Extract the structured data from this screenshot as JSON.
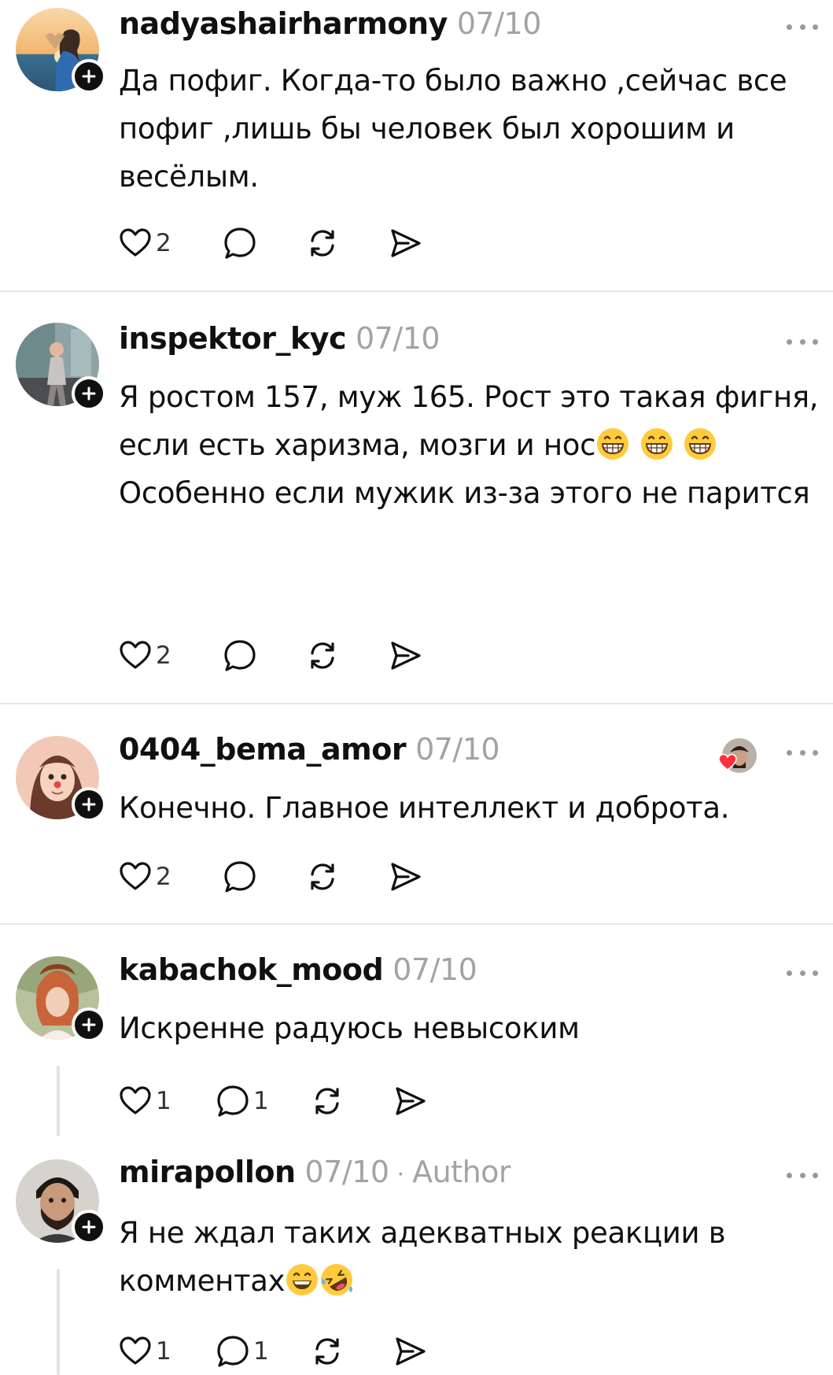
{
  "colors": {
    "text": "#101010",
    "muted": "#a3a3a3",
    "divider": "#e6e6e6",
    "heart_red": "#ff2d3f",
    "emoji_yellow": "#ffcb3d"
  },
  "posts": [
    {
      "username": "nadyashairharmony",
      "date": "07/10",
      "text": "Да пофиг. Когда-то было важно ,сейчас все пофиг ,лишь бы человек был хорошим и весёлым.",
      "likes": "2",
      "replies": "",
      "icons": [
        "heart-icon",
        "comment-icon",
        "repost-icon",
        "share-icon"
      ]
    },
    {
      "username": "inspektor_kyc",
      "date": "07/10",
      "text_line1": "Я ростом 157, муж 165. Рост это такая фигня, если есть харизма, мозги и нос",
      "text_emojis": [
        "grinning-face-emoji",
        "grinning-face-emoji",
        "grinning-face-emoji"
      ],
      "text_line2": "Особенно если мужик из-за этого не парится",
      "likes": "2",
      "replies": ""
    },
    {
      "username": "0404_bema_amor",
      "date": "07/10",
      "text": "Конечно. Главное интеллект и доброта.",
      "likes": "2",
      "replies": "",
      "liked_by_author": true
    },
    {
      "username": "kabachok_mood",
      "date": "07/10",
      "text": "Искренне радуюсь невысоким",
      "likes": "1",
      "replies": "1"
    },
    {
      "username": "mirapollon",
      "date": "07/10",
      "separator": "·",
      "author_label": "Author",
      "text": "Я не ждал таких адекватных реакции в комментах",
      "text_emojis": [
        "smiling-face-emoji",
        "rolling-laughing-emoji"
      ],
      "likes": "1",
      "replies": "1"
    }
  ]
}
